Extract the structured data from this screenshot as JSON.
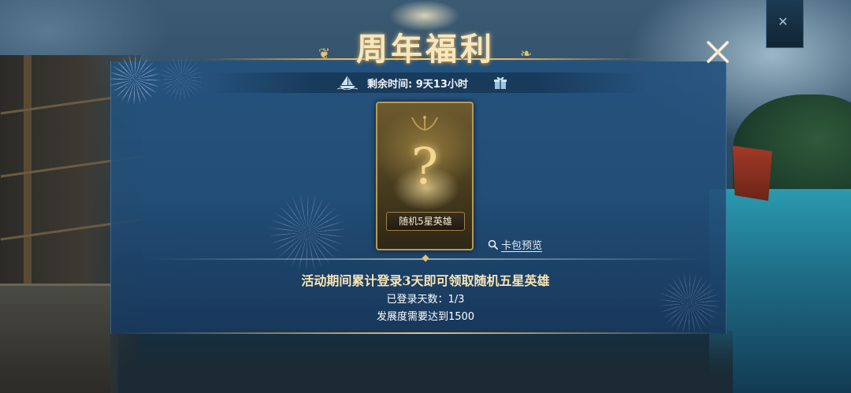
{
  "header": {
    "title": "周年福利",
    "background_title_fragment": "周年"
  },
  "timer": {
    "label": "剩余时间: 9天13小时",
    "icons": [
      "sailboat-icon",
      "gift-icon"
    ]
  },
  "reward_card": {
    "label": "随机5星英雄",
    "symbol": "?"
  },
  "preview_link": {
    "label": "卡包预览",
    "icon": "search-icon"
  },
  "details": {
    "description": "活动期间累计登录3天即可领取随机五星英雄",
    "progress_text": "已登录天数：1/3",
    "requirement_text": "发展度需要达到1500"
  },
  "progress": {
    "days_logged": 1,
    "days_required": 3
  },
  "colors": {
    "gold": "#f7e7bd",
    "panel_blue": "#24527e",
    "text_white": "#ffffff"
  }
}
